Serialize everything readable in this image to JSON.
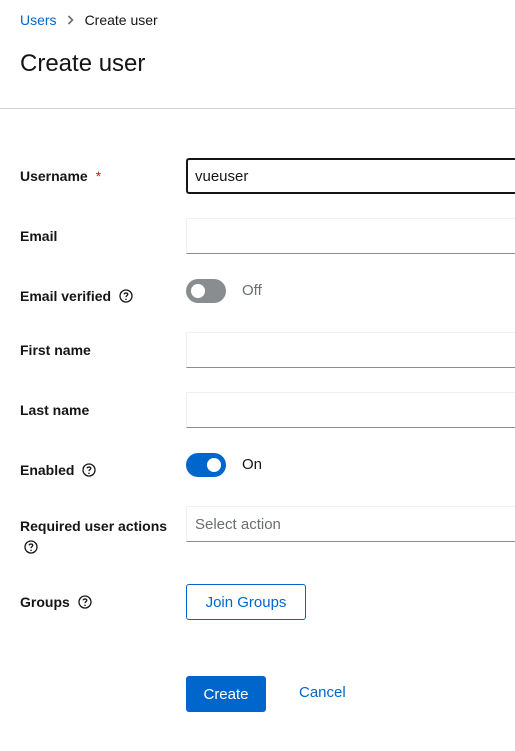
{
  "breadcrumb": {
    "parent": "Users",
    "current": "Create user"
  },
  "page_title": "Create user",
  "form": {
    "username": {
      "label": "Username",
      "required_marker": "*",
      "value": "vueuser"
    },
    "email": {
      "label": "Email",
      "value": ""
    },
    "email_verified": {
      "label": "Email verified",
      "state_text": "Off",
      "checked": false
    },
    "first_name": {
      "label": "First name",
      "value": ""
    },
    "last_name": {
      "label": "Last name",
      "value": ""
    },
    "enabled": {
      "label": "Enabled",
      "state_text": "On",
      "checked": true
    },
    "required_actions": {
      "label": "Required user actions",
      "placeholder": "Select action"
    },
    "groups": {
      "label": "Groups",
      "button_label": "Join Groups"
    }
  },
  "actions": {
    "create_label": "Create",
    "cancel_label": "Cancel"
  },
  "colors": {
    "accent": "#0066cc",
    "text": "#151515",
    "muted": "#6a6e73",
    "switch_off": "#8a8d90"
  }
}
